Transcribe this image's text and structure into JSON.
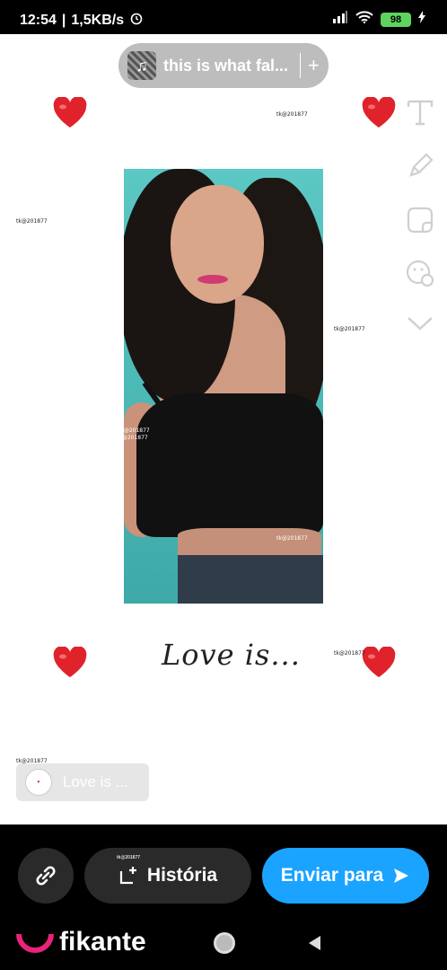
{
  "status": {
    "time": "12:54",
    "network_speed": "1,5KB/s",
    "battery": "98"
  },
  "music": {
    "title": "this is what fal...",
    "add_label": "+"
  },
  "watermark": "tk@201877",
  "caption_sticker": "Love is...",
  "story_chip": {
    "avatar_text": "Love is...",
    "label": "Love is ..."
  },
  "tools": [
    "text-icon",
    "pencil-icon",
    "sticker-icon",
    "emoji-icon",
    "chevron-down-icon"
  ],
  "actions": {
    "historia_label": "História",
    "historia_watermark": "tk@201877",
    "enviar_label": "Enviar para"
  },
  "brand": {
    "name": "fikante"
  },
  "colors": {
    "accent": "#1aa3ff",
    "heart": "#e0222a",
    "brand": "#e8237a",
    "battery": "#5fd35f"
  }
}
